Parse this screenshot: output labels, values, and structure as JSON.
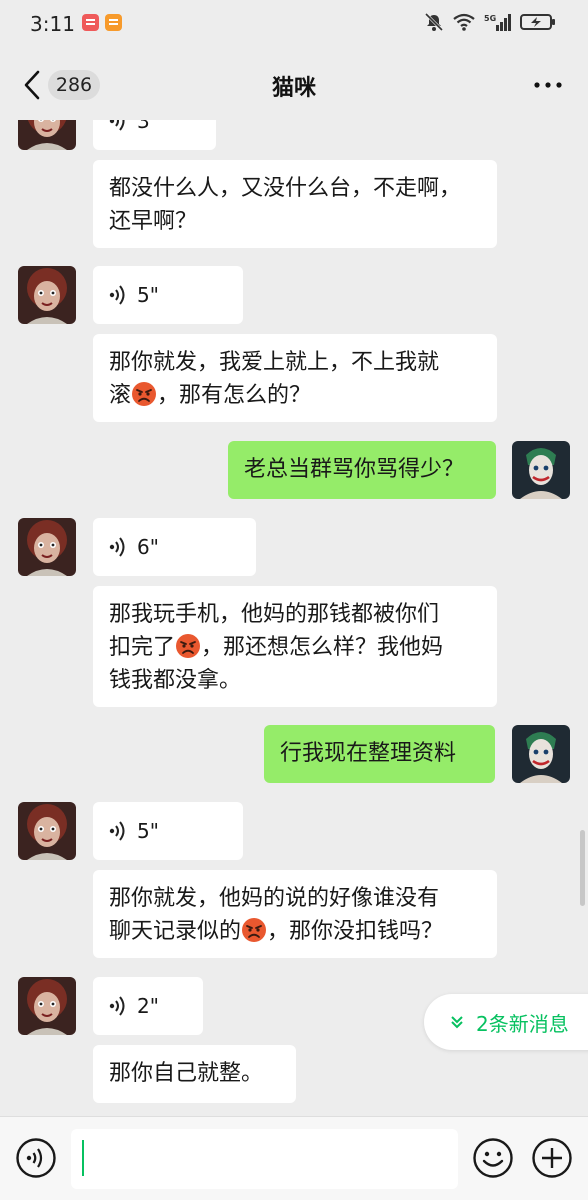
{
  "status_bar": {
    "time": "3:11",
    "network": "5G"
  },
  "header": {
    "back_count": "286",
    "title": "猫咪"
  },
  "messages": [
    {
      "side": "in",
      "type": "voice",
      "duration": "3\""
    },
    {
      "side": "in",
      "type": "text",
      "lines": [
        "都没什么人，又没什么台，不走啊，",
        "还早啊？"
      ]
    },
    {
      "side": "in",
      "type": "voice",
      "duration": "5\""
    },
    {
      "side": "in",
      "type": "text",
      "lines": [
        "那你就发，我爱上就上，不上我就",
        "滚{angry}，那有怎么的？"
      ]
    },
    {
      "side": "out",
      "type": "text",
      "lines": [
        "老总当群骂你骂得少？"
      ]
    },
    {
      "side": "in",
      "type": "voice",
      "duration": "6\""
    },
    {
      "side": "in",
      "type": "text",
      "lines": [
        "那我玩手机，他妈的那钱都被你们",
        "扣完了{angry}，那还想怎么样？我他妈",
        "钱我都没拿。"
      ]
    },
    {
      "side": "out",
      "type": "text",
      "lines": [
        "行我现在整理资料"
      ]
    },
    {
      "side": "in",
      "type": "voice",
      "duration": "5\""
    },
    {
      "side": "in",
      "type": "text",
      "lines": [
        "那你就发，他妈的说的好像谁没有",
        "聊天记录似的{angry}，那你没扣钱吗？"
      ]
    },
    {
      "side": "in",
      "type": "voice",
      "duration": "2\""
    },
    {
      "side": "in",
      "type": "text",
      "lines": [
        "那你自己就整。"
      ]
    }
  ],
  "new_messages": {
    "label": "2条新消息"
  },
  "input": {
    "value": ""
  },
  "colors": {
    "accent": "#07c160",
    "out_bubble": "#95ec69",
    "in_bubble": "#ffffff",
    "background": "#ededed"
  },
  "icons": [
    "back-arrow-icon",
    "more-icon",
    "voice-icon",
    "emoji-icon",
    "plus-icon",
    "angry-face-icon",
    "double-chevron-down-icon",
    "mute-bell-icon",
    "wifi-icon",
    "signal-icon",
    "battery-charging-icon"
  ]
}
